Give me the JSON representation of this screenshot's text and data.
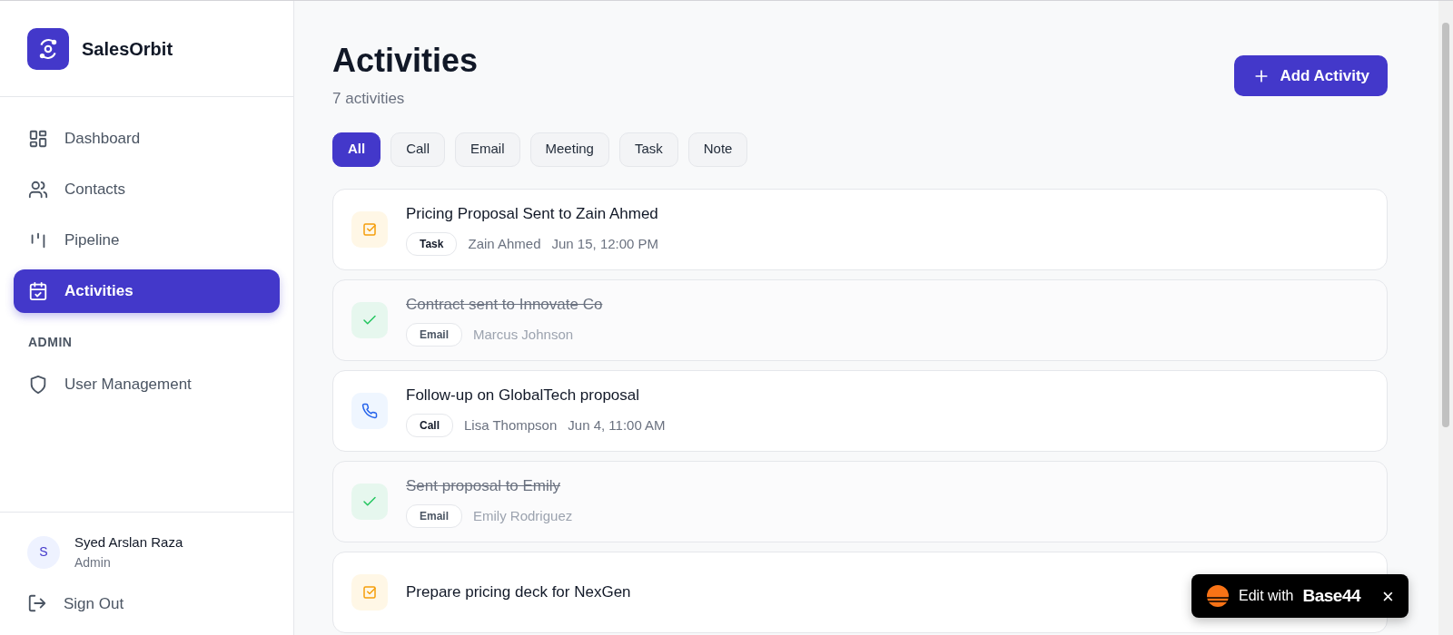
{
  "brand": {
    "name": "SalesOrbit"
  },
  "nav": [
    {
      "label": "Dashboard",
      "selected": false
    },
    {
      "label": "Contacts",
      "selected": false
    },
    {
      "label": "Pipeline",
      "selected": false
    },
    {
      "label": "Activities",
      "selected": true
    }
  ],
  "admin_section": {
    "heading": "ADMIN",
    "items": [
      {
        "label": "User Management",
        "selected": false
      }
    ]
  },
  "user": {
    "initial": "S",
    "name": "Syed Arslan Raza",
    "role": "Admin"
  },
  "sign_out": "Sign Out",
  "header": {
    "title": "Activities",
    "count": "7 activities",
    "add_button": "Add Activity"
  },
  "filters": [
    {
      "label": "All",
      "selected": true
    },
    {
      "label": "Call",
      "selected": false
    },
    {
      "label": "Email",
      "selected": false
    },
    {
      "label": "Meeting",
      "selected": false
    },
    {
      "label": "Task",
      "selected": false
    },
    {
      "label": "Note",
      "selected": false
    }
  ],
  "activities": [
    {
      "kind": "task",
      "done": false,
      "title": "Pricing Proposal Sent to Zain Ahmed",
      "tag": "Task",
      "contact": "Zain Ahmed",
      "date": "Jun 15, 12:00 PM"
    },
    {
      "done": true,
      "title": "Contract sent to Innovate Co",
      "tag": "Email",
      "contact": "Marcus Johnson"
    },
    {
      "kind": "call",
      "done": false,
      "title": "Follow-up on GlobalTech proposal",
      "tag": "Call",
      "contact": "Lisa Thompson",
      "date": "Jun 4, 11:00 AM"
    },
    {
      "done": true,
      "title": "Sent proposal to Emily",
      "tag": "Email",
      "contact": "Emily Rodriguez"
    },
    {
      "kind": "task",
      "done": false,
      "title": "Prepare pricing deck for NexGen"
    }
  ],
  "editor_badge": {
    "label": "Edit with",
    "brand": "Base44",
    "close": "×"
  }
}
